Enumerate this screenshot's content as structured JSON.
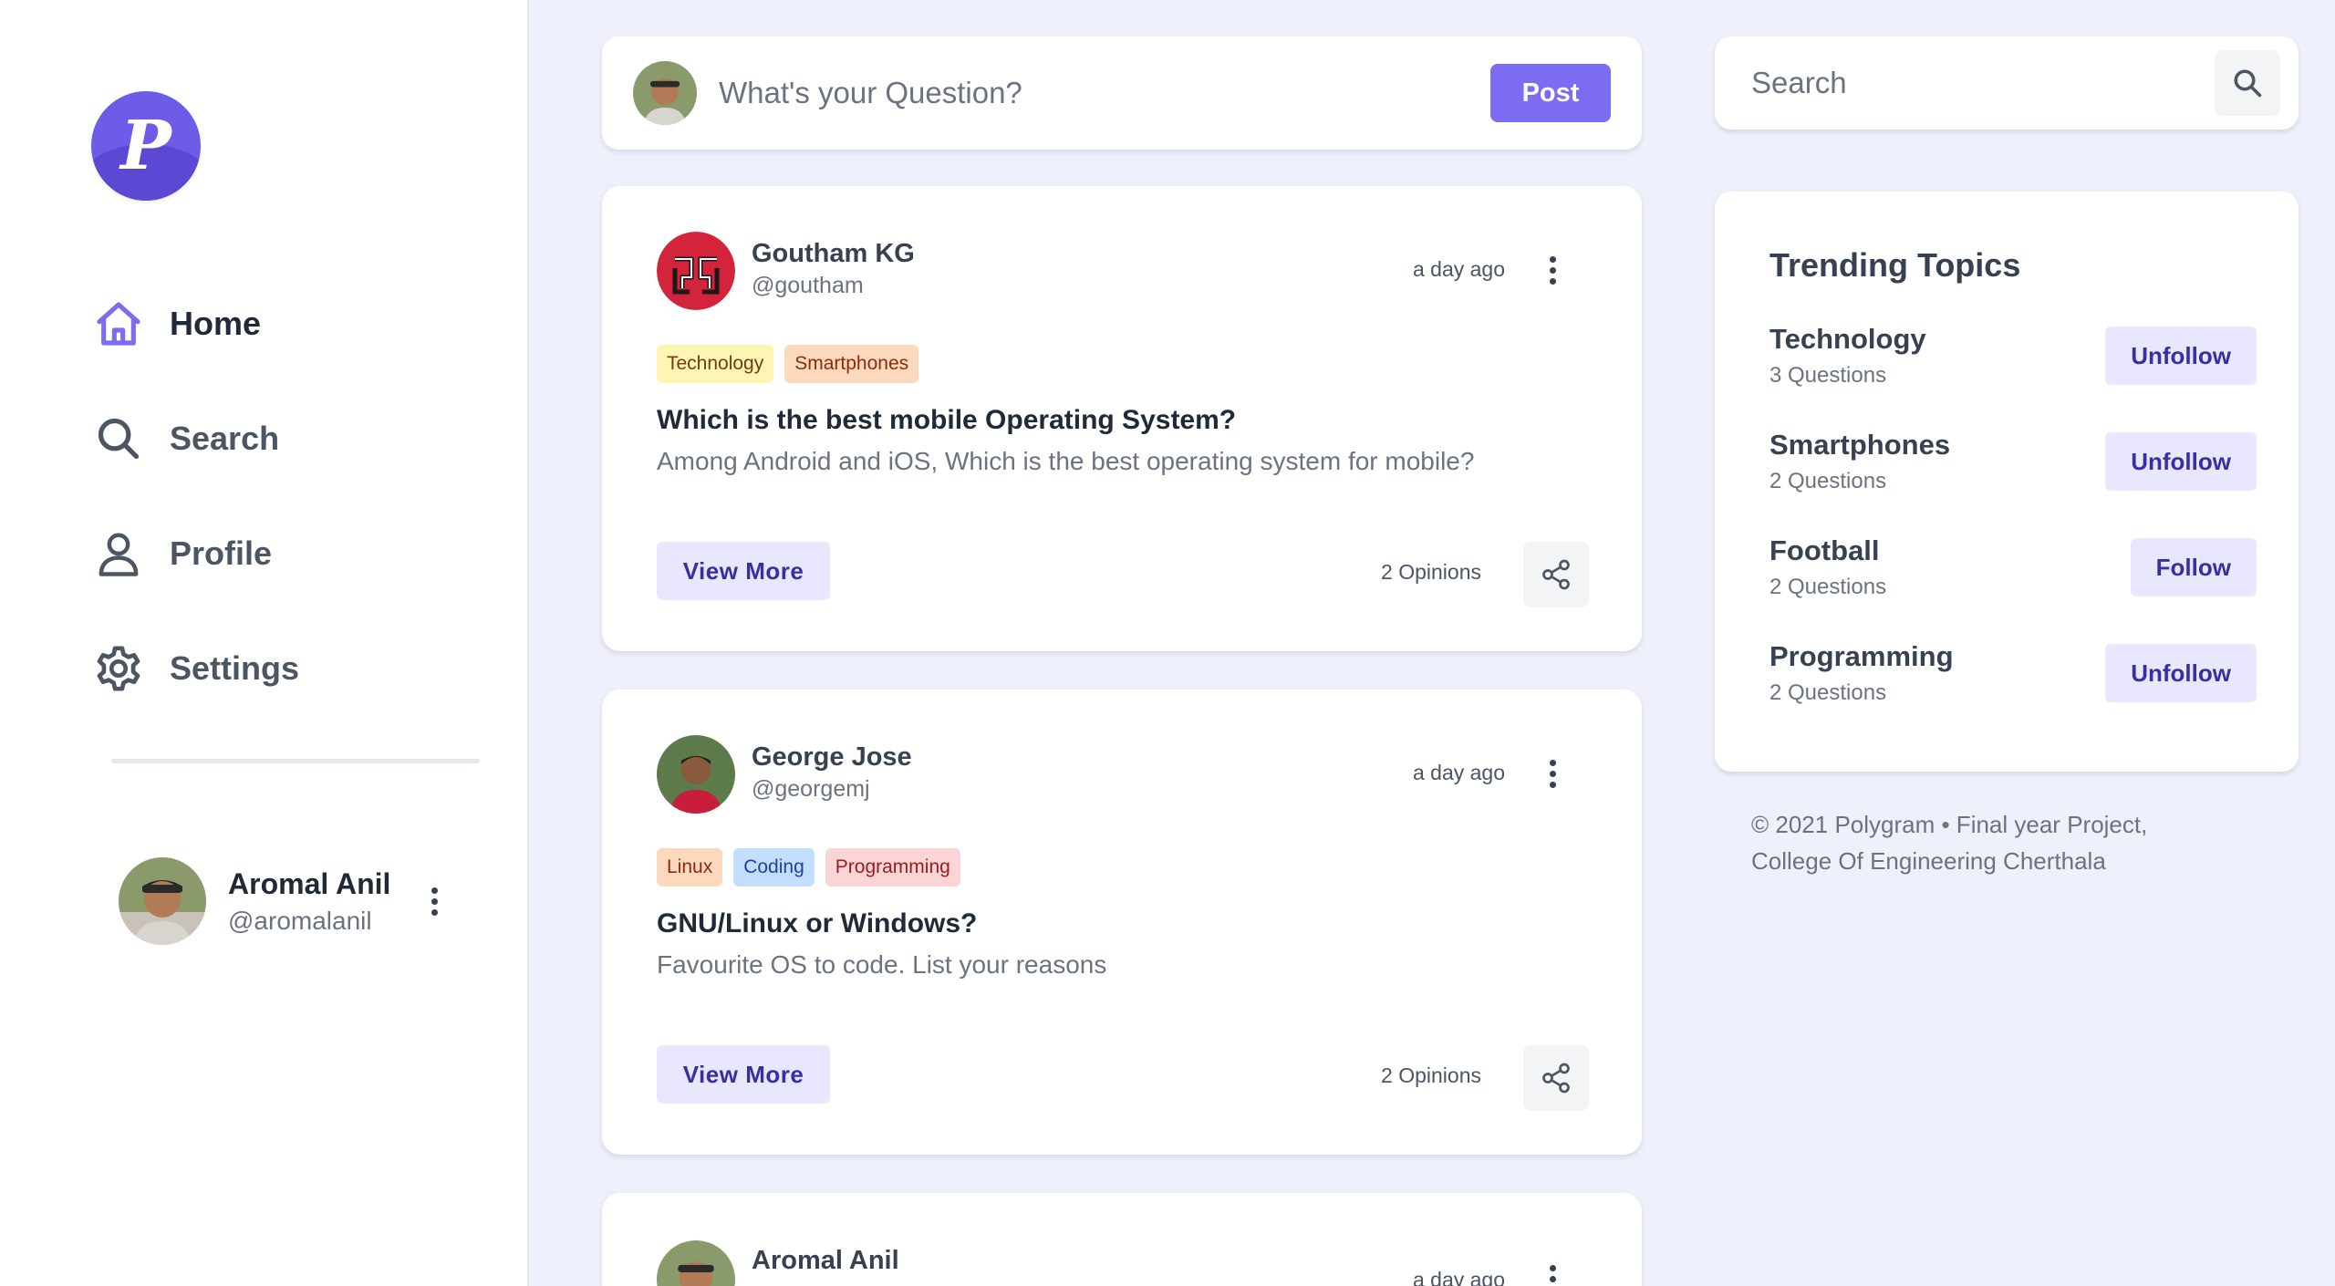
{
  "app": {
    "logo_letter": "P"
  },
  "sidebar": {
    "items": [
      {
        "label": "Home",
        "icon": "home-icon",
        "active": true
      },
      {
        "label": "Search",
        "icon": "search-icon"
      },
      {
        "label": "Profile",
        "icon": "user-icon"
      },
      {
        "label": "Settings",
        "icon": "gear-icon"
      }
    ],
    "user": {
      "name": "Aromal Anil",
      "handle": "@aromalanil"
    }
  },
  "composer": {
    "placeholder": "What's your Question?",
    "post_label": "Post"
  },
  "posts": [
    {
      "author": "Goutham KG",
      "handle": "@goutham",
      "time": "a day ago",
      "tags": [
        "Technology",
        "Smartphones"
      ],
      "title": "Which is the best mobile Operating System?",
      "body": "Among Android and iOS, Which is the best operating system for mobile?",
      "view_more": "View More",
      "opinions": "2 Opinions"
    },
    {
      "author": "George Jose",
      "handle": "@georgemj",
      "time": "a day ago",
      "tags": [
        "Linux",
        "Coding",
        "Programming"
      ],
      "title": "GNU/Linux or Windows?",
      "body": "Favourite OS to code. List your reasons",
      "view_more": "View More",
      "opinions": "2 Opinions"
    },
    {
      "author": "Aromal Anil",
      "time": "a day ago"
    }
  ],
  "search": {
    "placeholder": "Search"
  },
  "trending": {
    "title": "Trending Topics",
    "topics": [
      {
        "name": "Technology",
        "count": "3 Questions",
        "action": "Unfollow"
      },
      {
        "name": "Smartphones",
        "count": "2 Questions",
        "action": "Unfollow"
      },
      {
        "name": "Football",
        "count": "2 Questions",
        "action": "Follow"
      },
      {
        "name": "Programming",
        "count": "2 Questions",
        "action": "Unfollow"
      }
    ]
  },
  "footer": {
    "line1": "© 2021 Polygram • Final year Project,",
    "line2": "College Of Engineering Cherthala"
  },
  "colors": {
    "accent": "#7c6cf2",
    "soft_button": "#e9e7fd",
    "background": "#eef0fb",
    "tag_technology": "#fdf6b2",
    "tag_smartphones": "#fcd9bd",
    "tag_linux": "#fcd9bd",
    "tag_coding": "#c3ddfd",
    "tag_programming": "#fbd5d5"
  }
}
